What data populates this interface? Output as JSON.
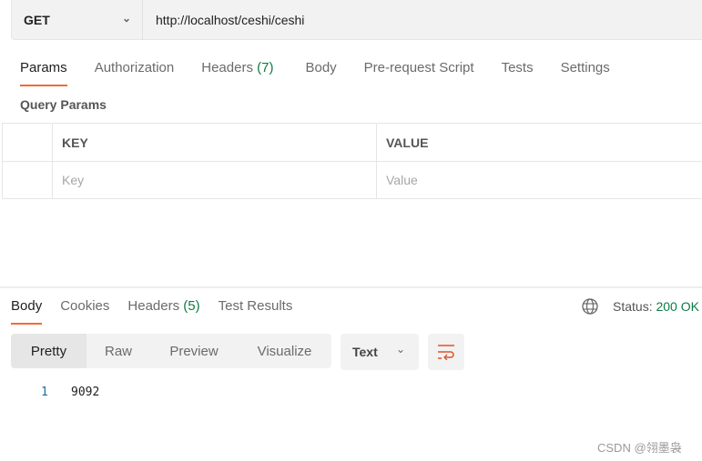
{
  "request": {
    "method": "GET",
    "url": "http://localhost/ceshi/ceshi"
  },
  "request_tabs": [
    {
      "label": "Params"
    },
    {
      "label": "Authorization"
    },
    {
      "label": "Headers",
      "count": "(7)"
    },
    {
      "label": "Body"
    },
    {
      "label": "Pre-request Script"
    },
    {
      "label": "Tests"
    },
    {
      "label": "Settings"
    }
  ],
  "query_params": {
    "title": "Query Params",
    "headers": [
      "KEY",
      "VALUE"
    ],
    "placeholders": [
      "Key",
      "Value"
    ]
  },
  "response_tabs": [
    {
      "label": "Body"
    },
    {
      "label": "Cookies"
    },
    {
      "label": "Headers",
      "count": "(5)"
    },
    {
      "label": "Test Results"
    }
  ],
  "status": {
    "label": "Status:",
    "value": "200 OK"
  },
  "view_modes": [
    "Pretty",
    "Raw",
    "Preview",
    "Visualize"
  ],
  "format": "Text",
  "body_lines": [
    {
      "num": "1",
      "text": "9092"
    }
  ],
  "watermark": "CSDN @翎墨袅",
  "colors": {
    "accent": "#f26b3a",
    "success": "#0f7b44"
  }
}
